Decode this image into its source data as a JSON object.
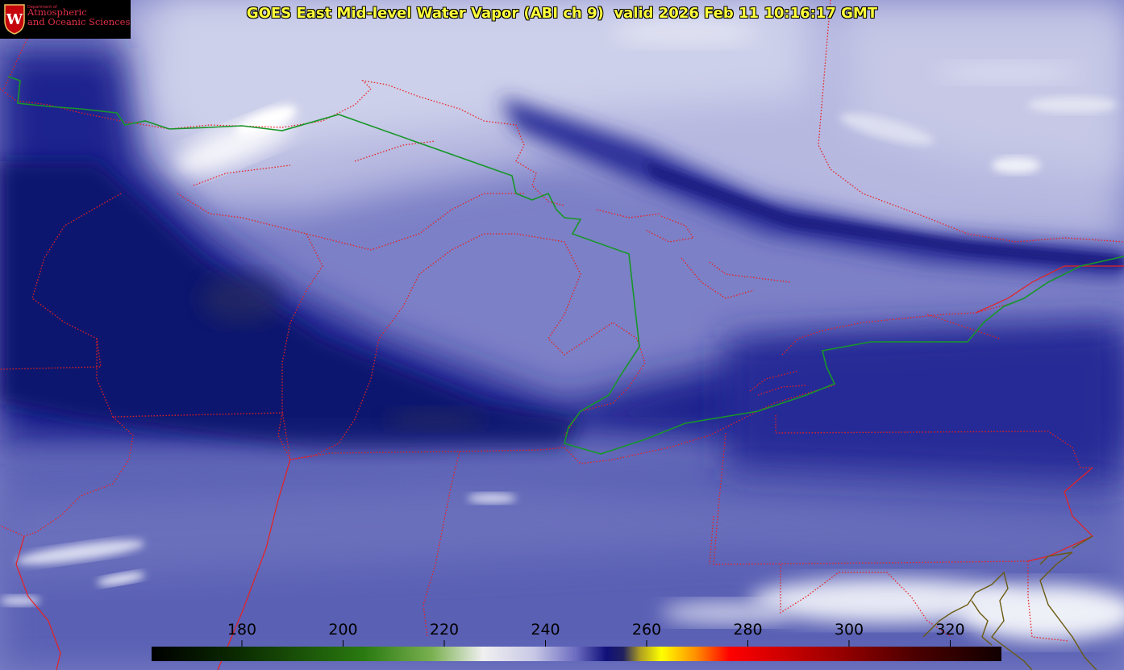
{
  "header": {
    "title": "GOES East Mid-level Water Vapor (ABI ch 9)  valid 2026 Feb 11 10:16:17 GMT"
  },
  "logo": {
    "dept_line": "Department of",
    "line1": "Atmospheric",
    "line2": "and Oceanic Sciences",
    "crest_letter": "W"
  },
  "colorbar": {
    "ticks": [
      "180",
      "200",
      "220",
      "240",
      "260",
      "280",
      "300",
      "320"
    ],
    "colors": [
      "#000000",
      "#0b3b00",
      "#2f8a12",
      "#a8c98a",
      "#ffffff",
      "#c0c0e0",
      "#2020a0",
      "#000060",
      "#ffff00",
      "#ff8000",
      "#ff0000",
      "#8b0000",
      "#2a0000",
      "#000000"
    ]
  },
  "colors": {
    "border": "#e82020",
    "canada_us_border": "#18962a",
    "coast": "#6a5a10",
    "title": "#ffff3a"
  }
}
